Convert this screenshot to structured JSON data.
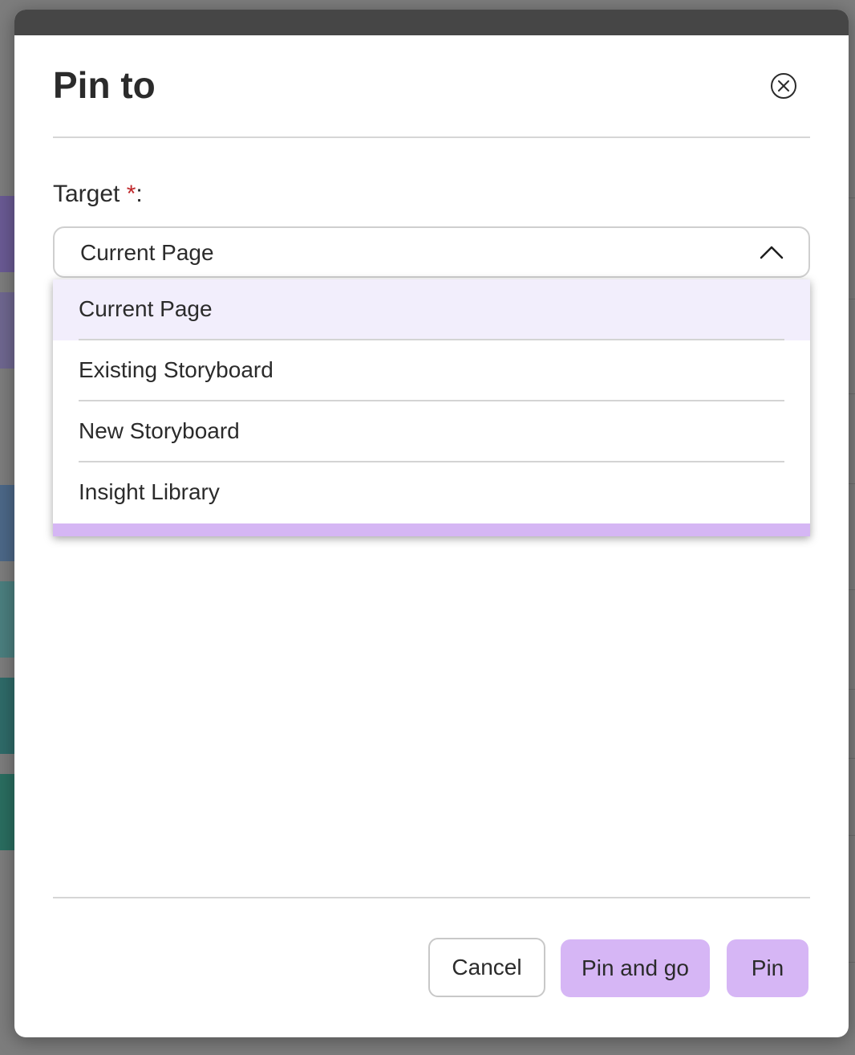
{
  "modal": {
    "title": "Pin to",
    "close_icon": "close-circle-icon"
  },
  "form": {
    "target_label": "Target",
    "required_marker": "*",
    "label_suffix": ":",
    "selected_value": "Current Page",
    "chevron_icon": "chevron-up-icon"
  },
  "dropdown": {
    "options": [
      {
        "label": "Current Page",
        "highlighted": true
      },
      {
        "label": "Existing Storyboard",
        "highlighted": false
      },
      {
        "label": "New Storyboard",
        "highlighted": false
      },
      {
        "label": "Insight Library",
        "highlighted": false
      }
    ]
  },
  "footer": {
    "cancel_label": "Cancel",
    "pin_and_go_label": "Pin and go",
    "pin_label": "Pin"
  },
  "colors": {
    "primary_button": "#d6b6f5",
    "highlight_option": "#f2eefc",
    "required": "#c0282b",
    "topbar": "#464646"
  }
}
